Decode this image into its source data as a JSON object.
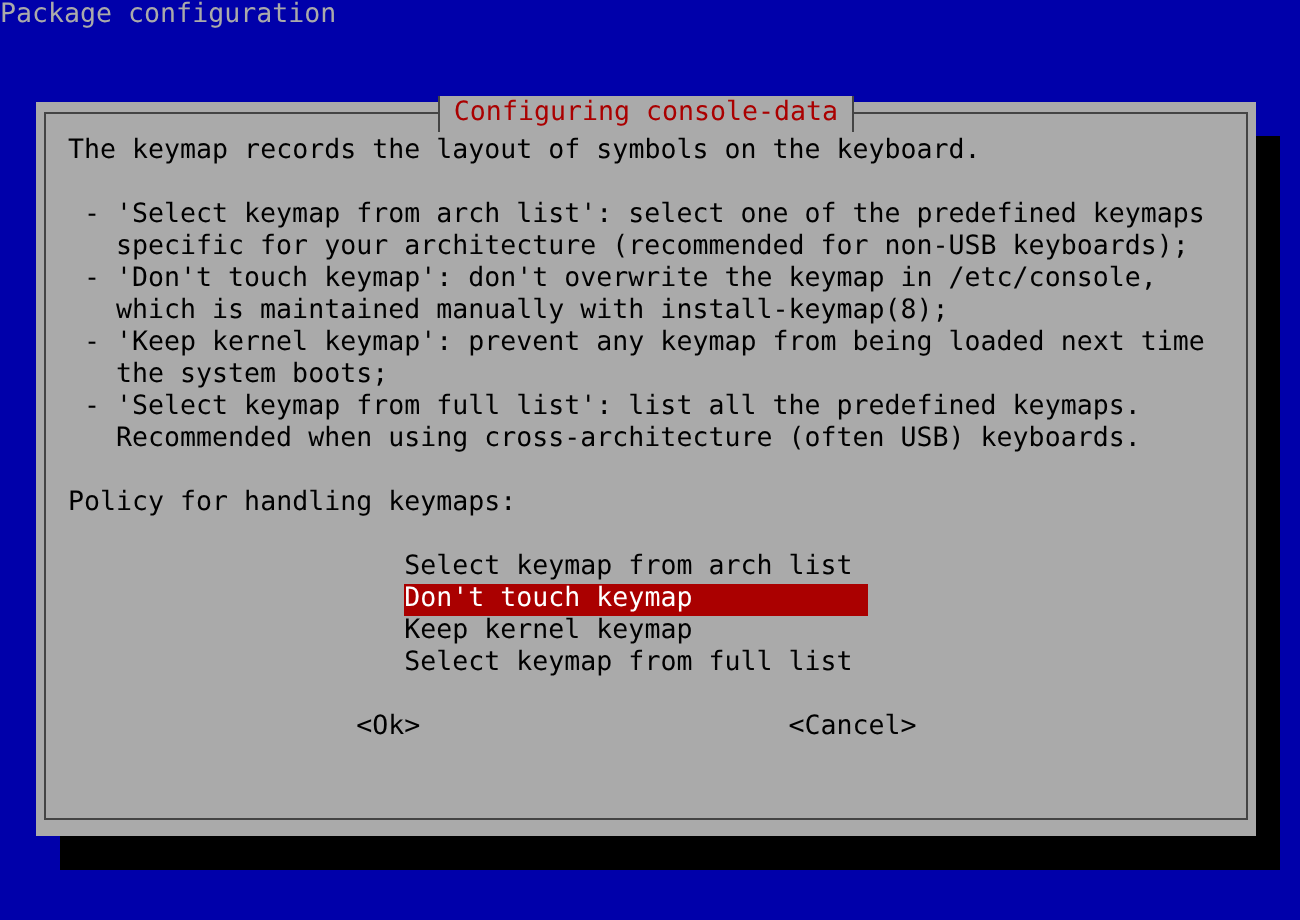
{
  "screen_title": "Package configuration",
  "dialog": {
    "title": "Configuring console-data",
    "intro": "The keymap records the layout of symbols on the keyboard.",
    "bullets": [
      {
        "marker": "-",
        "text": "'Select keymap from arch list': select one of the predefined keymaps\nspecific for your architecture (recommended for non-USB keyboards);"
      },
      {
        "marker": "-",
        "text": "'Don't touch keymap': don't overwrite the keymap in /etc/console,\nwhich is maintained manually with install-keymap(8);"
      },
      {
        "marker": "-",
        "text": "'Keep kernel keymap': prevent any keymap from being loaded next time\nthe system boots;"
      },
      {
        "marker": "-",
        "text": "'Select keymap from full list': list all the predefined keymaps.\nRecommended when using cross-architecture (often USB) keyboards."
      }
    ],
    "prompt": "Policy for handling keymaps:",
    "options": [
      {
        "label": "Select keymap from arch list",
        "selected": false
      },
      {
        "label": "Don't touch keymap",
        "selected": true
      },
      {
        "label": "Keep kernel keymap",
        "selected": false
      },
      {
        "label": "Select keymap from full list",
        "selected": false
      }
    ],
    "buttons": [
      "<Ok>",
      "<Cancel>"
    ]
  }
}
